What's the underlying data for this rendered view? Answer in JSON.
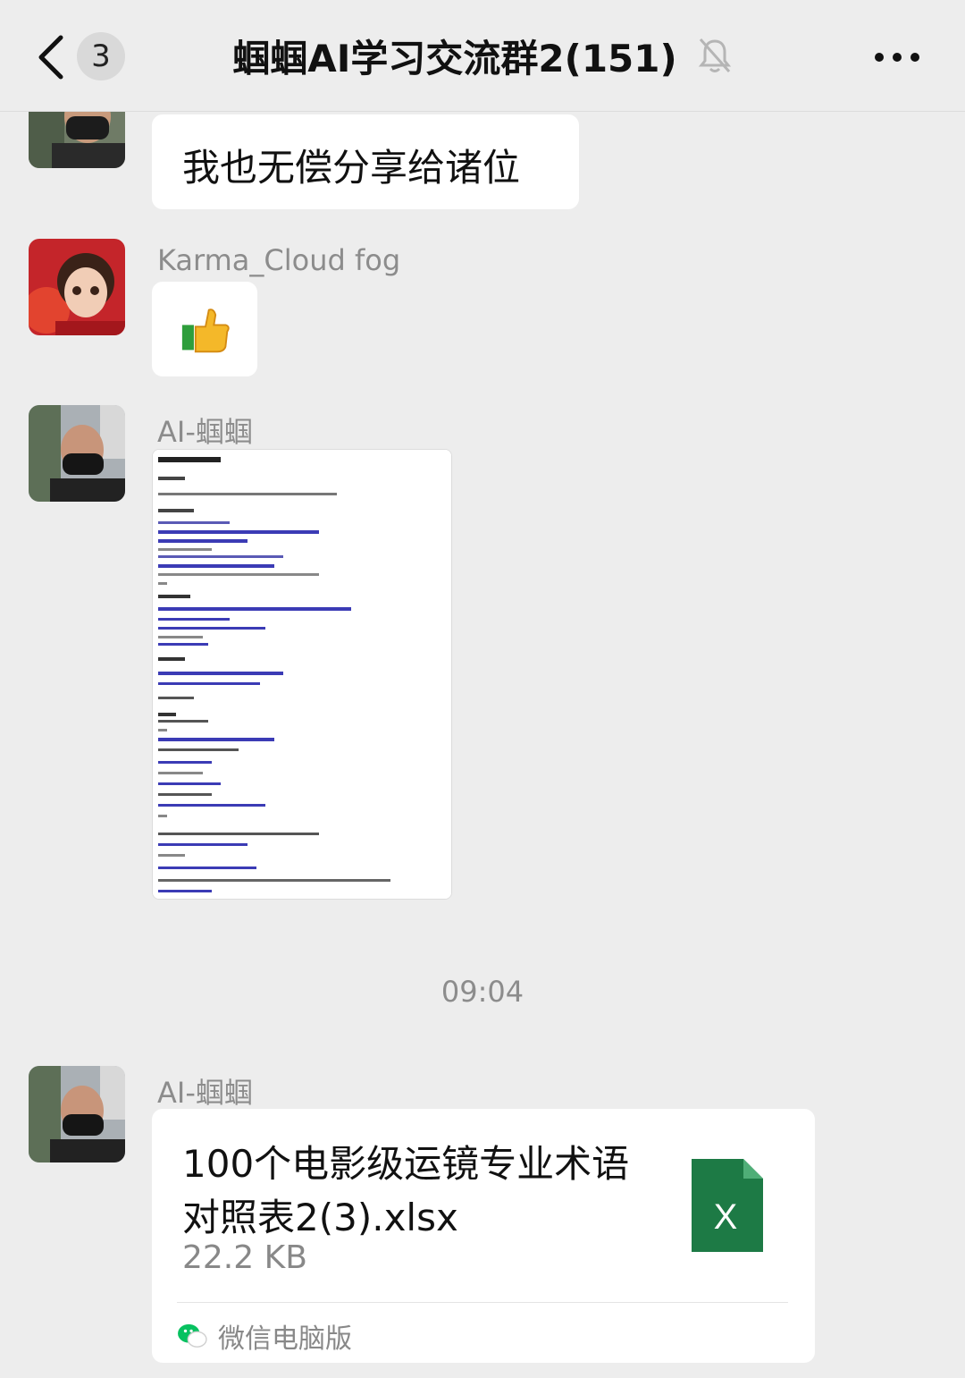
{
  "header": {
    "back_label": "back",
    "unread_count": "3",
    "title": "蝈蝈AI学习交流群2(151)",
    "mute_icon": "bell-muted-icon",
    "more_icon": "ellipsis-icon"
  },
  "messages": [
    {
      "sender": "",
      "type": "text",
      "text": "我也无偿分享给诸位"
    },
    {
      "sender": "Karma_Cloud fog",
      "type": "emoji",
      "emoji": "👍"
    },
    {
      "sender": "AI-蝈蝈",
      "type": "image",
      "description_icon": "document-screenshot"
    },
    {
      "sender": "AI-蝈蝈",
      "type": "file",
      "file_name": "100个电影级运镜专业术语对照表2(3).xlsx",
      "file_size": "22.2 KB",
      "source": "微信电脑版",
      "file_icon": "excel-icon",
      "file_icon_letter": "X"
    }
  ],
  "timestamp": "09:04",
  "colors": {
    "background": "#ededed",
    "bubble": "#ffffff",
    "excel_green": "#1d7a45",
    "wechat_green": "#07c160"
  }
}
